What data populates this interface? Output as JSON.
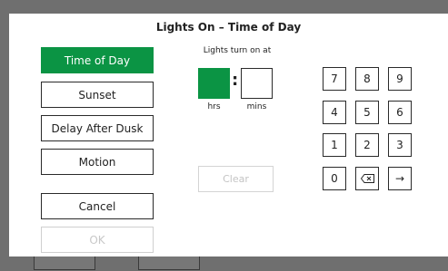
{
  "dialog": {
    "title": "Lights On – Time of Day"
  },
  "modes": [
    {
      "label": "Time of Day",
      "selected": true
    },
    {
      "label": "Sunset",
      "selected": false
    },
    {
      "label": "Delay After Dusk",
      "selected": false
    },
    {
      "label": "Motion",
      "selected": false
    }
  ],
  "actions": {
    "cancel_label": "Cancel",
    "ok_label": "OK"
  },
  "time_entry": {
    "heading": "Lights turn on at",
    "hours_value": "",
    "minutes_value": "",
    "separator": ":",
    "hours_label": "hrs",
    "minutes_label": "mins",
    "clear_label": "Clear"
  },
  "keypad": {
    "keys": [
      "7",
      "8",
      "9",
      "4",
      "5",
      "6",
      "1",
      "2",
      "3",
      "0"
    ],
    "backspace_icon": "backspace-icon",
    "enter_label": "→"
  },
  "colors": {
    "accent": "#0b9444",
    "dialog_bg": "#ffffff",
    "backdrop": "#6f6f6f"
  }
}
